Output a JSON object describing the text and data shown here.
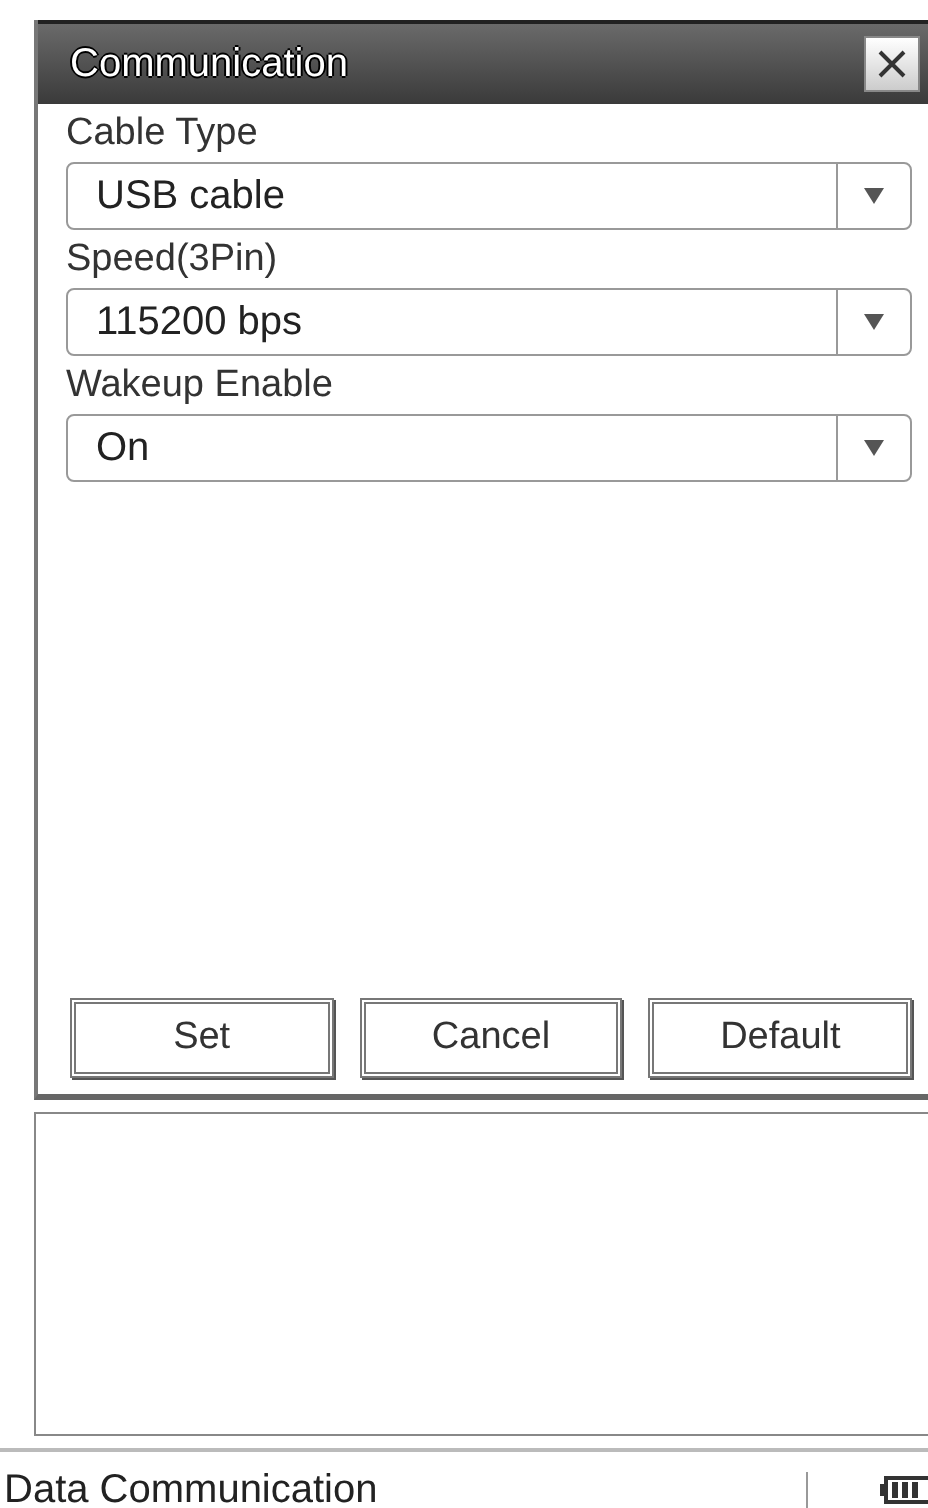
{
  "dialog": {
    "title": "Communication",
    "fields": [
      {
        "label": "Cable Type",
        "value": "USB cable"
      },
      {
        "label": "Speed(3Pin)",
        "value": "115200 bps"
      },
      {
        "label": "Wakeup Enable",
        "value": "On"
      }
    ],
    "buttons": [
      "Set",
      "Cancel",
      "Default"
    ]
  },
  "status_bar": {
    "text": "Data Communication"
  }
}
